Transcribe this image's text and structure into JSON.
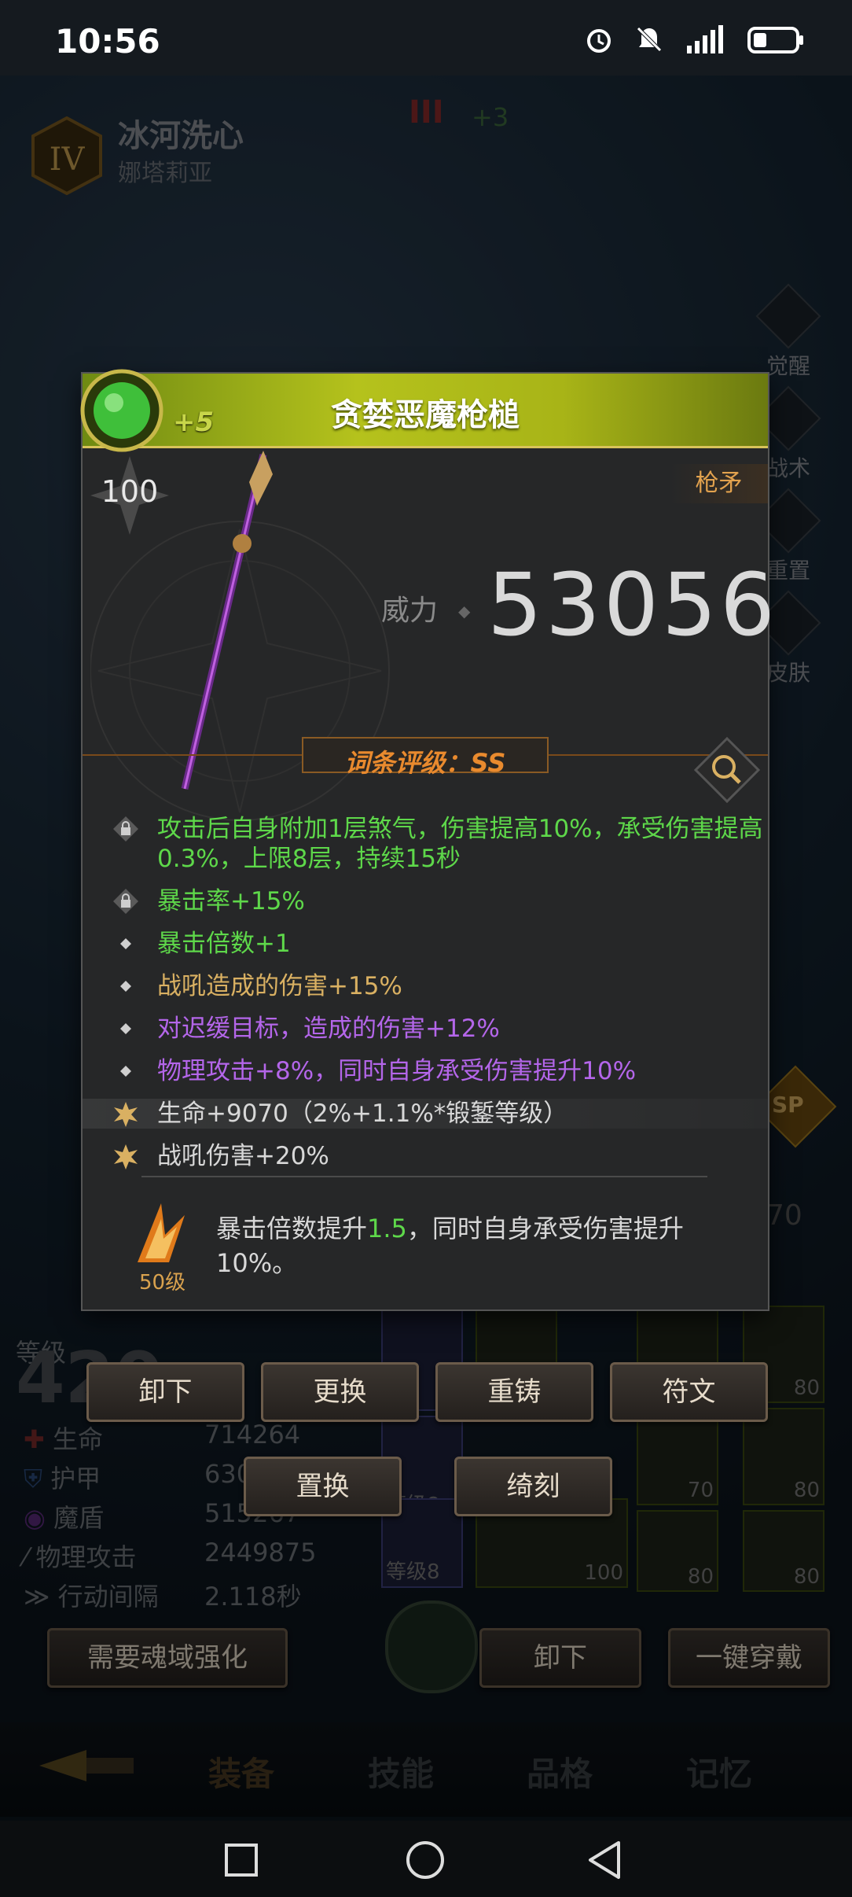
{
  "status_bar": {
    "time": "10:56"
  },
  "hero": {
    "name": "冰河洗心",
    "subtitle": "娜塔莉亚",
    "rank": "IV",
    "top_mark": "III",
    "top_plus": "+3"
  },
  "side_menu": [
    "觉醒",
    "战术",
    "重置",
    "皮肤"
  ],
  "item": {
    "title": "贪婪恶魔枪槌",
    "enhance": "+5",
    "level": "100",
    "type": "枪矛",
    "power_label": "威力",
    "power_value": "53056",
    "rating": "词条评级：SS",
    "properties": [
      {
        "text": "攻击后自身附加1层煞气，伤害提高10%，承受伤害提高0.3%，上限8层，持续15秒",
        "color": "green",
        "icon": "lock-icon"
      },
      {
        "text": "暴击率+15%",
        "color": "green",
        "icon": "lock-icon"
      },
      {
        "text": "暴击倍数+1",
        "color": "green",
        "icon": "diamond-icon"
      },
      {
        "text": "战吼造成的伤害+15%",
        "color": "gold",
        "icon": "diamond-icon"
      },
      {
        "text": "对迟缓目标，造成的伤害+12%",
        "color": "purple",
        "icon": "diamond-icon"
      },
      {
        "text": "物理攻击+8%，同时自身承受伤害提升10%",
        "color": "purple",
        "icon": "diamond-icon"
      },
      {
        "text": "生命+9070（2%+1.1%*锻錾等级）",
        "color": "white",
        "icon": "star-icon"
      },
      {
        "text": "战吼伤害+20%",
        "color": "white",
        "icon": "star-icon"
      }
    ],
    "skill": {
      "level": "50级",
      "text_before": "暴击倍数提升",
      "number": "1.5",
      "text_after": "，同时自身承受伤害提升10%。"
    }
  },
  "actions": {
    "unequip": "卸下",
    "replace": "更换",
    "reforge": "重铸",
    "rune": "符文",
    "swap": "置换",
    "engrave": "绮刻"
  },
  "stats": {
    "level_label": "等级",
    "level_value": "420",
    "rows": [
      {
        "label": "生命",
        "value": "714264"
      },
      {
        "label": "护甲",
        "value": "630"
      },
      {
        "label": "魔盾",
        "value": "515267"
      },
      {
        "label": "物理攻击",
        "value": "2449875"
      },
      {
        "label": "行动间隔",
        "value": "2.118秒"
      }
    ]
  },
  "bottom_buttons": {
    "soul": "需要魂域强化",
    "unequip": "卸下",
    "equip_all": "一键穿戴"
  },
  "gear_grid": {
    "slot_labels": [
      "等级8",
      "等级8"
    ],
    "levels": [
      "80",
      "80",
      "70",
      "80",
      "100",
      "80",
      "80"
    ],
    "sp_badge": "SP",
    "side_value": "70"
  },
  "tabs": [
    "装备",
    "技能",
    "品格",
    "记忆"
  ],
  "colors": {
    "green": "#5ed84a",
    "gold": "#d9b062",
    "purple": "#b466ea",
    "accent": "#e98a2e"
  }
}
